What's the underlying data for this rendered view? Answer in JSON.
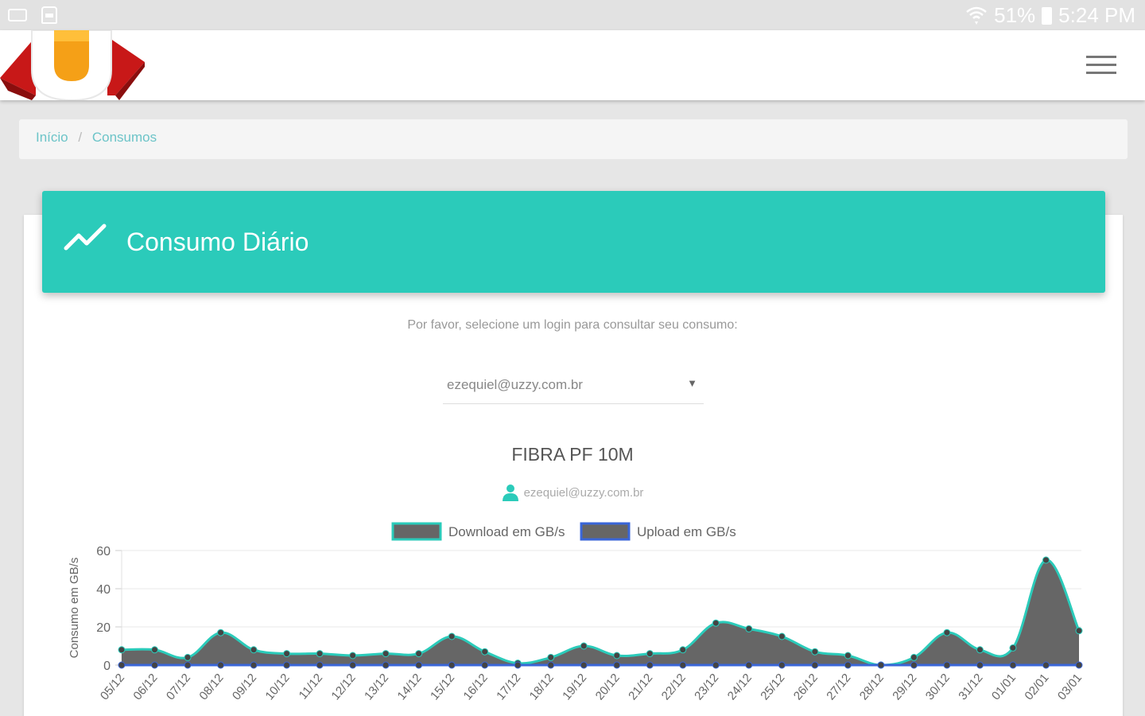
{
  "status_bar": {
    "battery": "51%",
    "time": "5:24 PM"
  },
  "breadcrumb": {
    "items": [
      "Início",
      "Consumos"
    ],
    "separator": "/"
  },
  "card": {
    "title": "Consumo Diário",
    "header_color": "#2bcbba",
    "prompt": "Por favor, selecione um login para consultar seu consumo:",
    "select_value": "ezequiel@uzzy.com.br",
    "plan": "FIBRA PF 10M",
    "user": "ezequiel@uzzy.com.br"
  },
  "chart_data": {
    "type": "area",
    "ylabel": "Consumo em GB/s",
    "ylim": [
      0,
      60
    ],
    "yticks": [
      0,
      20,
      40,
      60
    ],
    "grid": true,
    "legend_position": "top",
    "categories": [
      "05/12",
      "06/12",
      "07/12",
      "08/12",
      "09/12",
      "10/12",
      "11/12",
      "12/12",
      "13/12",
      "14/12",
      "15/12",
      "16/12",
      "17/12",
      "18/12",
      "19/12",
      "20/12",
      "21/12",
      "22/12",
      "23/12",
      "24/12",
      "25/12",
      "26/12",
      "27/12",
      "28/12",
      "29/12",
      "30/12",
      "31/12",
      "01/01",
      "02/01",
      "03/01"
    ],
    "series": [
      {
        "name": "Download em GB/s",
        "fill": "#666666",
        "line": "#2bcbba",
        "values": [
          8,
          8,
          4,
          17,
          8,
          6,
          6,
          5,
          6,
          6,
          15,
          7,
          1,
          4,
          10,
          5,
          6,
          8,
          22,
          19,
          15,
          7,
          5,
          0,
          4,
          17,
          8,
          9,
          55,
          18
        ]
      },
      {
        "name": "Upload em GB/s",
        "fill": "#666666",
        "line": "#3a66d8",
        "values": [
          0,
          0,
          0,
          0,
          0,
          0,
          0,
          0,
          0,
          0,
          0,
          0,
          0,
          0,
          0,
          0,
          0,
          0,
          0,
          0,
          0,
          0,
          0,
          0,
          0,
          0,
          0,
          0,
          0,
          0
        ]
      }
    ]
  }
}
